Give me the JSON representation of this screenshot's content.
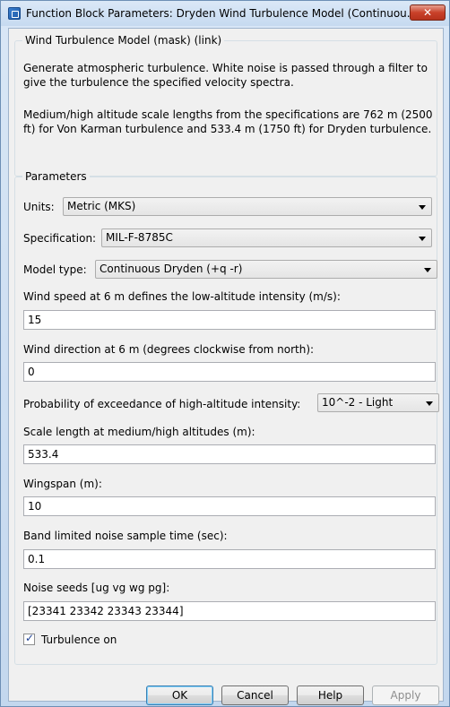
{
  "window": {
    "title": "Function Block Parameters: Dryden Wind Turbulence Model (Continuou...",
    "close_label": "✕"
  },
  "mask_group": {
    "label": "Wind Turbulence Model (mask) (link)",
    "description_1": "Generate atmospheric turbulence. White noise is passed through a filter to give the turbulence the specified velocity spectra.",
    "description_2": "Medium/high altitude scale lengths from the specifications are 762 m (2500 ft) for Von Karman turbulence and 533.4 m (1750 ft) for Dryden turbulence."
  },
  "parameters": {
    "label": "Parameters",
    "units": {
      "label": "Units:",
      "value": "Metric (MKS)"
    },
    "specification": {
      "label": "Specification:",
      "value": "MIL-F-8785C"
    },
    "model_type": {
      "label": "Model type:",
      "value": "Continuous Dryden (+q -r)"
    },
    "wind_speed": {
      "label": "Wind speed at 6 m defines the low-altitude intensity (m/s):",
      "value": "15"
    },
    "wind_direction": {
      "label": "Wind direction at 6 m (degrees clockwise from north):",
      "value": "0"
    },
    "probability": {
      "label": "Probability of exceedance of high-altitude intensity:",
      "value": "10^-2 - Light"
    },
    "scale_length": {
      "label": "Scale length at medium/high altitudes (m):",
      "value": "533.4"
    },
    "wingspan": {
      "label": "Wingspan (m):",
      "value": "10"
    },
    "sample_time": {
      "label": "Band limited noise sample time (sec):",
      "value": "0.1"
    },
    "noise_seeds": {
      "label": "Noise seeds [ug vg wg pg]:",
      "value": "[23341 23342 23343 23344]"
    },
    "turbulence": {
      "label": "Turbulence on",
      "checked": true,
      "mark": "✓"
    }
  },
  "buttons": {
    "ok": "OK",
    "cancel": "Cancel",
    "help": "Help",
    "apply": "Apply"
  },
  "icons": {
    "app": "simulink-block-icon",
    "close": "close-icon",
    "dropdown": "chevron-down-icon",
    "check": "checkmark-icon"
  }
}
